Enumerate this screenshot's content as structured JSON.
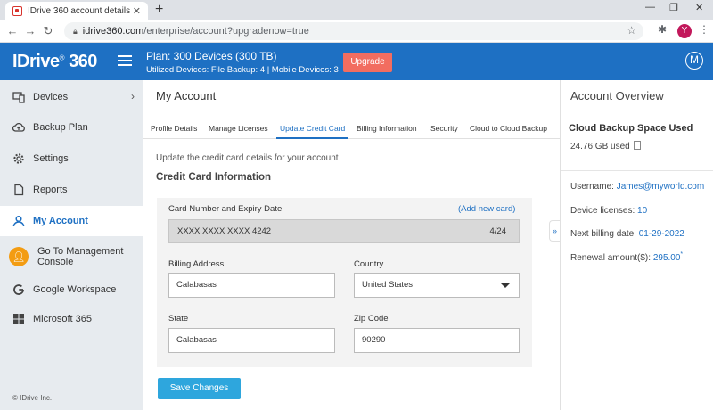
{
  "browser": {
    "tab_title": "IDrive 360 account details",
    "url_host": "idrive360.com",
    "url_path": "/enterprise/account?upgradenow=true",
    "profile_initial": "Y"
  },
  "header": {
    "logo": "IDrive",
    "logo_suffix": "360",
    "plan_title": "Plan: 300 Devices (300 TB)",
    "plan_sub": "Utilized Devices: File Backup: 4 |  Mobile Devices: 3",
    "upgrade_label": "Upgrade",
    "user_initial": "M"
  },
  "sidebar": {
    "items": [
      {
        "label": "Devices",
        "icon": "devices-icon"
      },
      {
        "label": "Backup Plan",
        "icon": "cloud-upload-icon"
      },
      {
        "label": "Settings",
        "icon": "gear-icon"
      },
      {
        "label": "Reports",
        "icon": "document-icon"
      },
      {
        "label": "My Account",
        "icon": "user-icon"
      },
      {
        "label": "Go To Management Console",
        "icon": "management-console-icon"
      },
      {
        "label": "Google Workspace",
        "icon": "google-icon"
      },
      {
        "label": "Microsoft 365",
        "icon": "microsoft-icon"
      }
    ],
    "copyright": "© IDrive Inc."
  },
  "main": {
    "title": "My Account",
    "tabs": [
      {
        "label": "Profile Details"
      },
      {
        "label": "Manage Licenses"
      },
      {
        "label": "Update Credit Card"
      },
      {
        "label": "Billing Information"
      },
      {
        "label": "Security"
      },
      {
        "label": "Cloud to Cloud Backup"
      }
    ],
    "active_tab": "Update Credit Card",
    "intro": "Update the credit card details for your account",
    "section_title": "Credit Card Information",
    "form": {
      "card_label": "Card Number and Expiry Date",
      "add_card": "(Add new card)",
      "card_number": "XXXX XXXX XXXX 4242",
      "card_expiry": "4/24",
      "billing_label": "Billing Address",
      "billing_value": "Calabasas",
      "country_label": "Country",
      "country_value": "United States",
      "state_label": "State",
      "state_value": "Calabasas",
      "zip_label": "Zip Code",
      "zip_value": "90290"
    },
    "save_label": "Save Changes"
  },
  "overview": {
    "title": "Account Overview",
    "subtitle": "Cloud  Backup Space Used",
    "used": "24.76 GB used",
    "username_label": "Username: ",
    "username": "James@myworld.com",
    "licenses_label": "Device licenses: ",
    "licenses": "10",
    "billing_label": "Next billing date: ",
    "billing_date": "01-29-2022",
    "renewal_label": "Renewal amount($): ",
    "renewal": "295.00",
    "renewal_mark": "*"
  },
  "colors": {
    "brand_blue": "#1e70c3",
    "upgrade": "#f26d60",
    "save_button": "#2ea6dd",
    "sidebar_bg": "#e7ebef"
  }
}
